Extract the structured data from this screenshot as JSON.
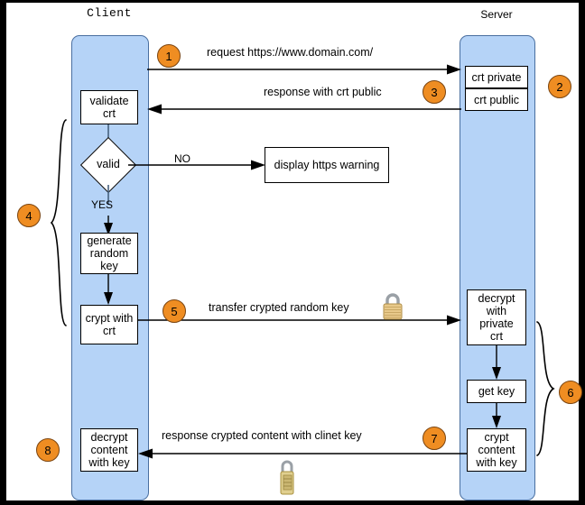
{
  "columns": {
    "client": "Client",
    "server": "Server"
  },
  "client_nodes": {
    "validate": "validate\ncrt",
    "decision": "valid",
    "yes_label": "YES",
    "no_label": "NO",
    "generate": "generate\nrandom\nkey",
    "crypt": "crypt with\ncrt",
    "decrypt_content": "decrypt\ncontent\nwith key"
  },
  "warning_box": "display https warning",
  "server_nodes": {
    "crt_private": "crt private",
    "crt_public": "crt public",
    "decrypt_private": "decrypt\nwith\nprivate\ncrt",
    "get_key": "get key",
    "crypt_content": "crypt\ncontent\nwith key"
  },
  "messages": {
    "request": "request https://www.domain.com/",
    "response_crt": "response with crt public",
    "transfer_key": "transfer crypted random key",
    "response_content": "response crypted content with clinet key"
  },
  "steps": {
    "s1": "1",
    "s2": "2",
    "s3": "3",
    "s4": "4",
    "s5": "5",
    "s6": "6",
    "s7": "7",
    "s8": "8"
  },
  "icons": {
    "lock_closed": "padlock-icon",
    "lock_combination": "combination-padlock-icon"
  },
  "colors": {
    "lifeline_fill": "#b5d3f7",
    "lifeline_stroke": "#4a6fa0",
    "step_fill": "#ef8d22",
    "step_stroke": "#7a4410",
    "box_stroke": "#000000",
    "frame": "#000000",
    "lock_body": "#e8c98a",
    "lock_shackle": "#9aa0a6"
  }
}
